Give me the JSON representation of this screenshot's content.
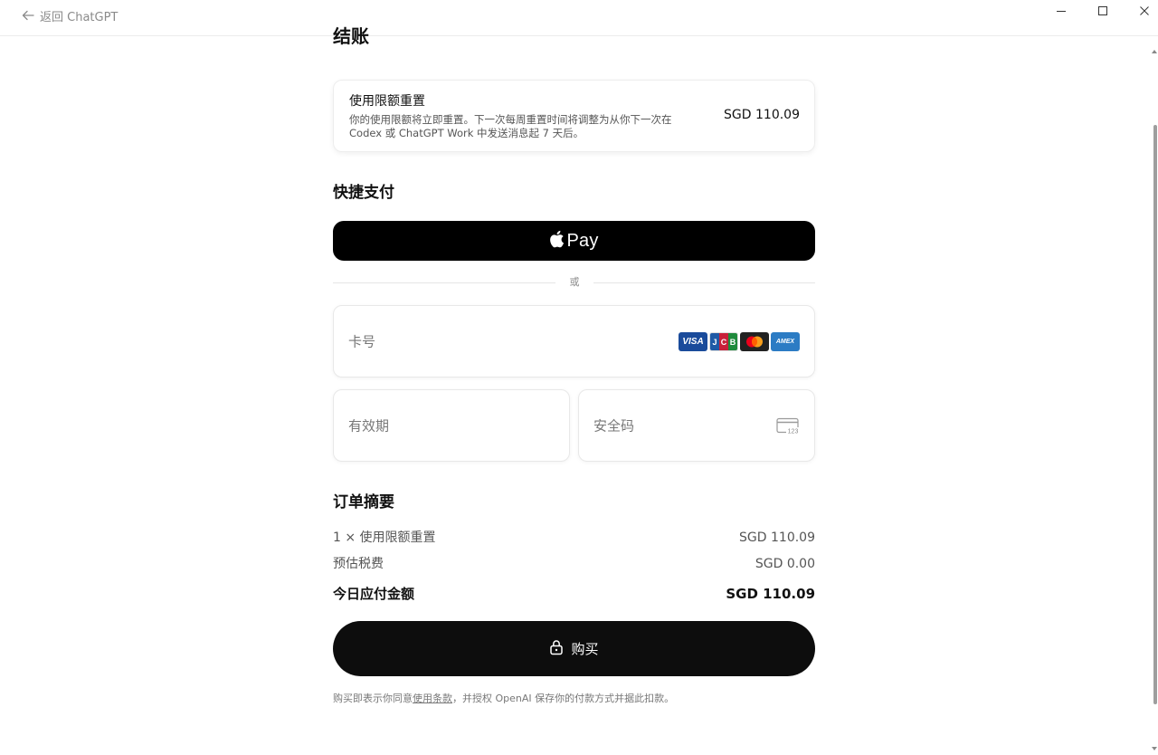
{
  "titlebar": {
    "back_label": "返回 ChatGPT"
  },
  "page": {
    "clipped_heading": "结账"
  },
  "reset_card": {
    "title": "使用限额重置",
    "description": "你的使用限额将立即重置。下一次每周重置时间将调整为从你下一次在 Codex 或 ChatGPT Work 中发送消息起 7 天后。",
    "price": "SGD 110.09"
  },
  "express": {
    "heading": "快捷支付",
    "apple_pay_label": "Pay",
    "or_label": "或"
  },
  "card_form": {
    "card_number_placeholder": "卡号",
    "expiry_placeholder": "有效期",
    "cvc_placeholder": "安全码",
    "brands": [
      "VISA",
      "JCB",
      "Mastercard",
      "AMEX"
    ],
    "visa_text": "VISA",
    "amex_text": "AMEX",
    "jcb_letters": [
      "J",
      "C",
      "B"
    ],
    "cvc_icon_text": "123"
  },
  "summary": {
    "heading": "订单摘要",
    "item_label": "1 × 使用限额重置",
    "item_value": "SGD 110.09",
    "tax_label": "预估税费",
    "tax_value": "SGD 0.00",
    "total_label": "今日应付金额",
    "total_value": "SGD 110.09"
  },
  "buy_button": {
    "label": "购买"
  },
  "legal": {
    "prefix": "购买即表示你同意",
    "terms_link": "使用条款",
    "suffix": "，并授权 OpenAI 保存你的付款方式并据此扣款。"
  },
  "colors": {
    "primary_button": "#0d0d0d",
    "apple_pay": "#000000",
    "visa": "#1a4b9b",
    "amex": "#2c7cc4"
  }
}
